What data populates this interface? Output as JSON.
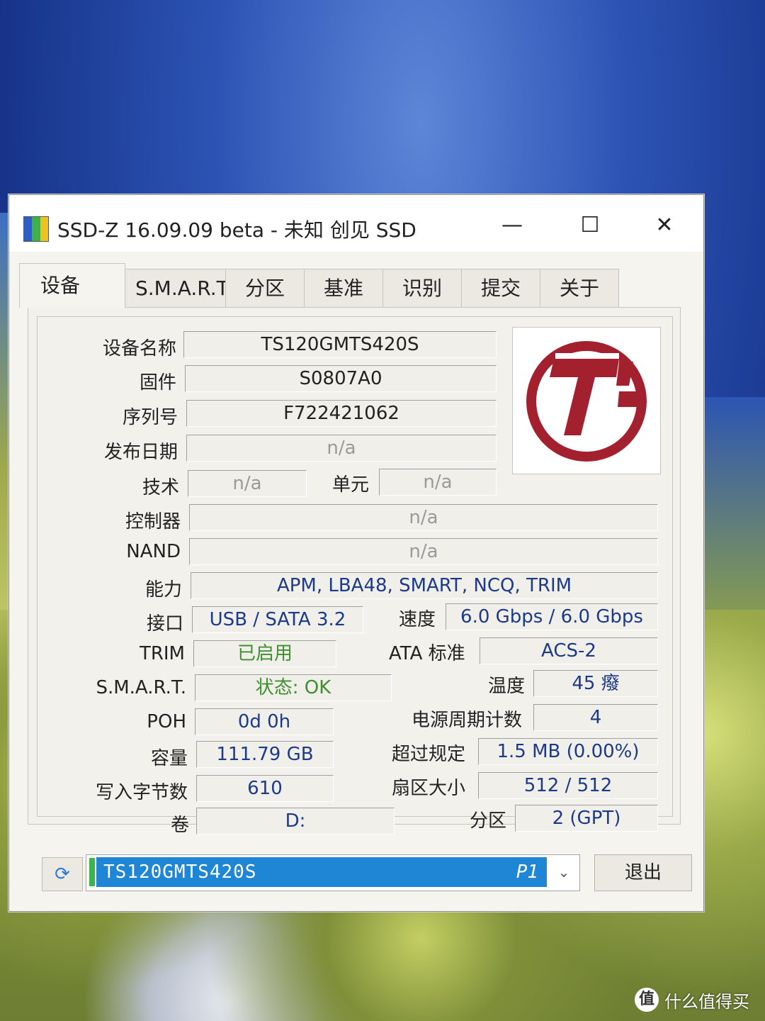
{
  "window": {
    "title": "SSD-Z 16.09.09 beta - 未知 创见 SSD",
    "minimize": "—",
    "maximize": "☐",
    "close": "✕",
    "icon": "ssdz-app-icon"
  },
  "tabs": [
    {
      "label": "设备",
      "active": true
    },
    {
      "label": "S.M.A.R.T."
    },
    {
      "label": "分区"
    },
    {
      "label": "基准"
    },
    {
      "label": "识别"
    },
    {
      "label": "提交"
    },
    {
      "label": "关于"
    }
  ],
  "fields": {
    "device_name": {
      "label": "设备名称",
      "value": "TS120GMTS420S"
    },
    "firmware": {
      "label": "固件",
      "value": "S0807A0"
    },
    "serial": {
      "label": "序列号",
      "value": "F722421062"
    },
    "release_date": {
      "label": "发布日期",
      "value": "n/a"
    },
    "technology": {
      "label": "技术",
      "value": "n/a"
    },
    "cell": {
      "label": "单元",
      "value": "n/a"
    },
    "controller": {
      "label": "控制器",
      "value": "n/a"
    },
    "nand": {
      "label": "NAND",
      "value": "n/a"
    },
    "capabilities": {
      "label": "能力",
      "value": "APM, LBA48, SMART, NCQ, TRIM"
    },
    "interface": {
      "label": "接口",
      "value": "USB / SATA 3.2"
    },
    "speed": {
      "label": "速度",
      "value": "6.0 Gbps / 6.0 Gbps"
    },
    "trim": {
      "label": "TRIM",
      "value": "已启用"
    },
    "ata_standard": {
      "label": "ATA 标准",
      "value": "ACS-2"
    },
    "smart": {
      "label": "S.M.A.R.T.",
      "value": "状态: OK"
    },
    "temperature": {
      "label": "温度",
      "value": "45 癈"
    },
    "poh": {
      "label": "POH",
      "value": "0d 0h"
    },
    "power_cycles": {
      "label": "电源周期计数",
      "value": "4"
    },
    "capacity": {
      "label": "容量",
      "value": "111.79 GB"
    },
    "over_provision": {
      "label": "超过规定",
      "value": "1.5 MB (0.00%)"
    },
    "bytes_written": {
      "label": "写入字节数",
      "value": "610"
    },
    "sector_size": {
      "label": "扇区大小",
      "value": "512 / 512"
    },
    "volume": {
      "label": "卷",
      "value": "D:"
    },
    "partition": {
      "label": "分区",
      "value": "2 (GPT)"
    }
  },
  "logo": {
    "icon": "transcend-logo",
    "color": "#a3202f"
  },
  "bottom": {
    "refresh_icon": "refresh-icon",
    "drive_select": {
      "name": "TS120GMTS420S",
      "tag": "P1"
    },
    "exit_label": "退出"
  },
  "watermark": {
    "icon_text": "值",
    "text": "什么值得买"
  },
  "colors": {
    "value_text": "#1c3a8a",
    "ok_text": "#3e8f2f",
    "na_text": "#9a9a9a",
    "selection": "#1f86d6"
  }
}
